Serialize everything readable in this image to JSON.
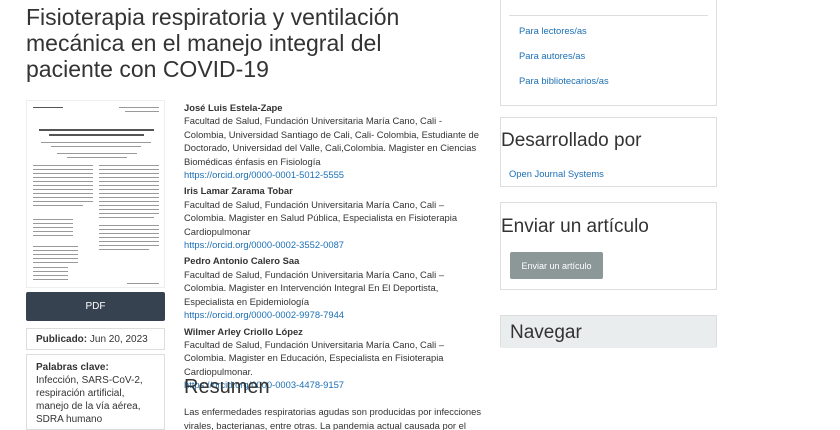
{
  "article": {
    "title": "Fisioterapia respiratoria y ventilación mecánica en el manejo integral del paciente con COVID-19",
    "pdf_label": "PDF",
    "published_label": "Publicado:",
    "published_date": "Jun 20, 2023",
    "keywords_label": "Palabras clave:",
    "keywords": "Infección, SARS-CoV-2, respiración artificial, manejo de la vía aérea, SDRA humano",
    "resumen_heading": "Resumen",
    "resumen_text": "Las enfermedades respiratorias agudas son producidas por infecciones virales, bacterianas, entre otras. La pandemia actual causada por el SARS-"
  },
  "authors": [
    {
      "name": "José Luis Estela-Zape",
      "affiliation": "Facultad de Salud, Fundación Universitaria María Cano, Cali - Colombia, Universidad Santiago de Cali, Cali- Colombia, Estudiante de Doctorado, Universidad del Valle, Cali,Colombia. Magister en Ciencias Biomédicas énfasis en Fisiología",
      "orcid": "https://orcid.org/0000-0001-5012-5555"
    },
    {
      "name": "Iris Lamar Zarama Tobar",
      "affiliation": "Facultad de Salud, Fundación Universitaria María Cano, Cali – Colombia. Magister en Salud Pública, Especialista en Fisioterapia Cardiopulmonar",
      "orcid": "https://orcid.org/0000-0002-3552-0087"
    },
    {
      "name": "Pedro Antonio Calero Saa",
      "affiliation": "Facultad de Salud, Fundación Universitaria María Cano, Cali – Colombia. Magister en Intervención Integral En El Deportista, Especialista en Epidemiología",
      "orcid": "https://orcid.org/0000-0002-9978-7944"
    },
    {
      "name": "Wilmer Arley Criollo López",
      "affiliation": "Facultad de Salud, Fundación Universitaria María Cano, Cali – Colombia. Magister en Educación, Especialista en Fisioterapia Cardiopulmonar.",
      "orcid": "https://orcid.org/0000-0003-4478-9157"
    }
  ],
  "sidebar": {
    "links": [
      "Para lectores/as",
      "Para autores/as",
      "Para bibliotecarios/as"
    ],
    "developed_heading": "Desarrollado por",
    "developed_link": "Open Journal Systems",
    "submit_heading": "Enviar un artículo",
    "submit_button": "Enviar un artículo",
    "navigate_heading": "Navegar"
  },
  "colors": {
    "link": "#1b6fb5",
    "pdf_button": "#364250",
    "submit_button": "#8c9797",
    "navigate_header": "#eaeded"
  }
}
